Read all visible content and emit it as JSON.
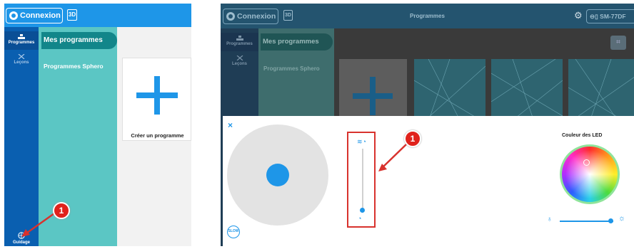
{
  "left_screen": {
    "connect_label": "Connexion",
    "icon_3d_label": "3D",
    "rail": {
      "programs_label": "Programmes",
      "lessons_label": "Leçons",
      "guide_label": "Guidage"
    },
    "panel": {
      "my_programs": "Mes programmes",
      "sphero_programs": "Programmes Sphero"
    },
    "create_card_label": "Créer un programme",
    "callout_number": "1"
  },
  "right_screen": {
    "connect_label": "Connexion",
    "icon_3d_label": "3D",
    "page_title": "Programmes",
    "device_label": "SM-77DF",
    "rail": {
      "programs_label": "Programmes",
      "lessons_label": "Leçons"
    },
    "panel": {
      "my_programs": "Mes programmes",
      "sphero_programs": "Programmes Sphero"
    },
    "drive": {
      "close_symbol": "×",
      "speed_badge": "SLOW",
      "speed_level": 0.05,
      "led_title": "Couleur des LED",
      "brightness_level": 0.95
    },
    "callout_number": "1"
  },
  "colors": {
    "accent_blue": "#1e96e8",
    "rail_blue": "#0a5fb0",
    "teal_panel": "#5bc6c4",
    "teal_active": "#12868a",
    "callout_red": "#e0221c"
  }
}
